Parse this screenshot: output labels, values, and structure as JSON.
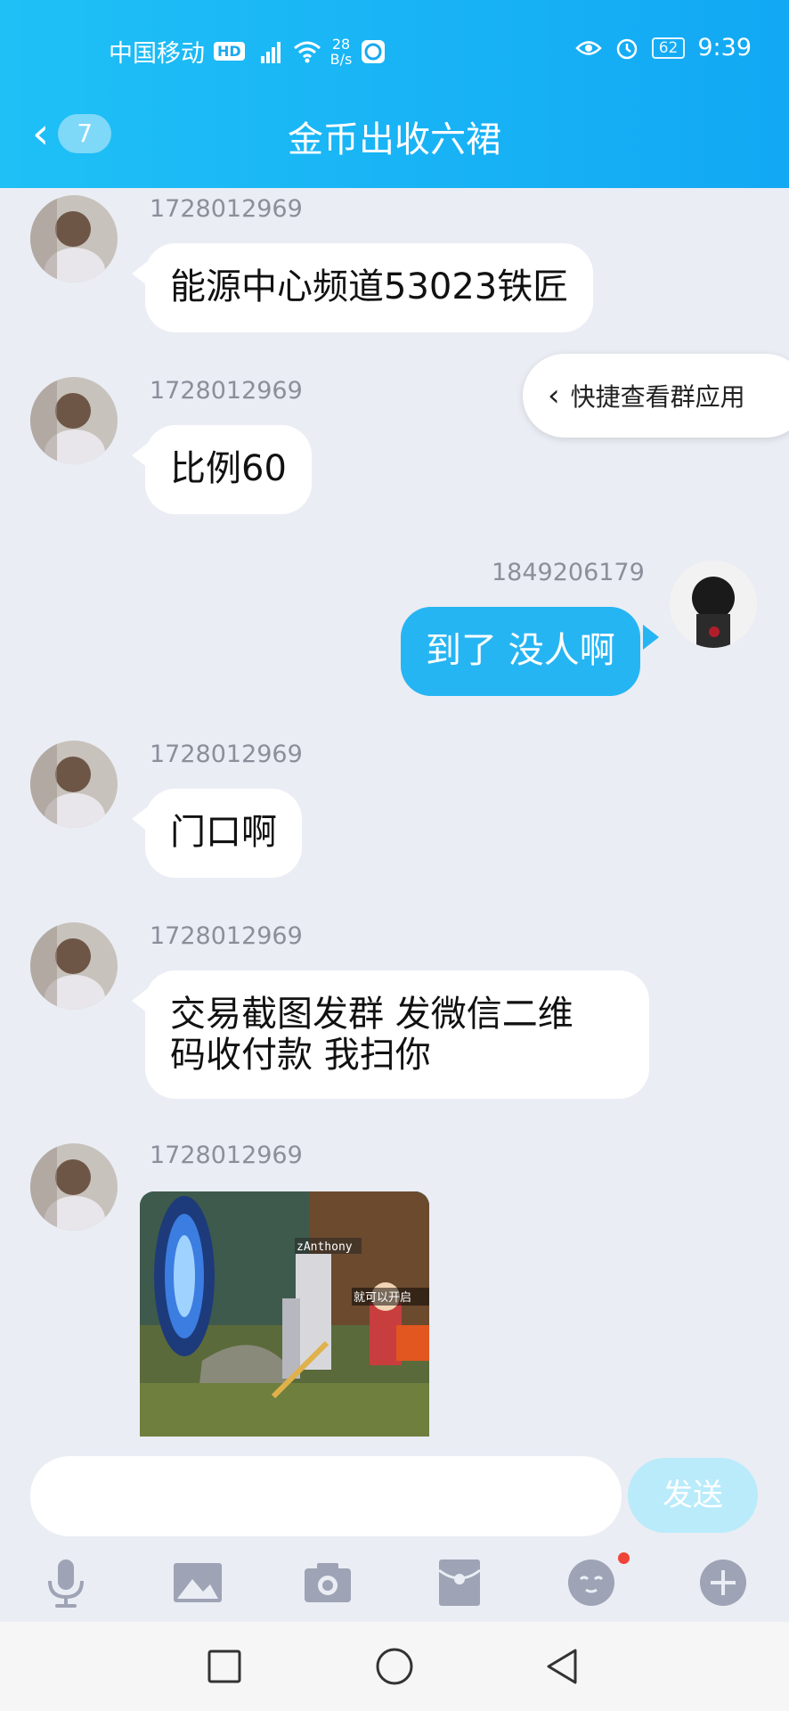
{
  "status_bar": {
    "carrier": "中国移动",
    "hd": "HD",
    "network": "46",
    "speed_value": "28",
    "speed_unit": "B/s",
    "battery": "62",
    "time": "9:39"
  },
  "header": {
    "back_count": "7",
    "title": "金币出收六裙"
  },
  "quick_view": "快捷查看群应用",
  "messages": [
    {
      "sender": "1728012969",
      "text": "能源中心频道53023铁匠"
    },
    {
      "sender": "1728012969",
      "text": "比例60"
    },
    {
      "sender": "1849206179",
      "text": "到了 没人啊"
    },
    {
      "sender": "1728012969",
      "text": "门口啊"
    },
    {
      "sender": "1728012969",
      "text_line1": "交易截图发群 发微信二维",
      "text_line2": "码收付款 我扫你"
    },
    {
      "sender": "1728012969",
      "image_caption": "zAnthony",
      "image_text": "就可以开启"
    }
  ],
  "input": {
    "placeholder": "",
    "send_label": "发送"
  },
  "toolbar_icons": [
    "microphone-icon",
    "image-icon",
    "camera-icon",
    "red-packet-icon",
    "emoji-icon",
    "plus-icon"
  ],
  "colors": {
    "header": "#12a8f4",
    "outgoing_bubble": "#26b5f3",
    "incoming_bubble": "#ffffff",
    "background": "#eaedf4"
  }
}
